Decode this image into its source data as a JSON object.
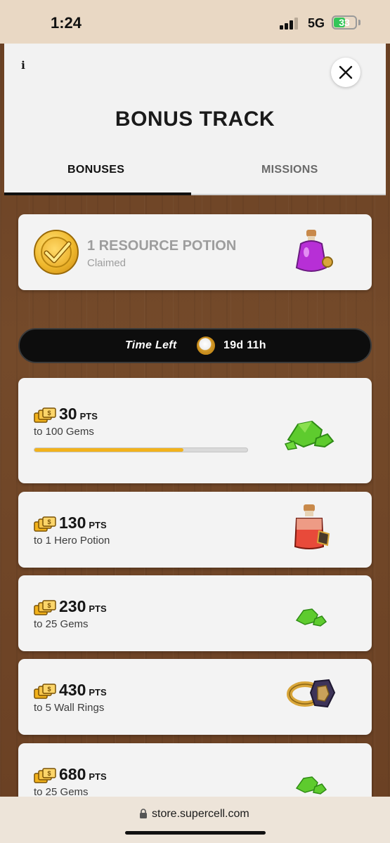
{
  "status_bar": {
    "time": "1:24",
    "network": "5G",
    "battery": "33"
  },
  "header": {
    "title": "BONUS TRACK",
    "info_icon": "i",
    "close_icon": "×"
  },
  "tabs": [
    {
      "label": "BONUSES",
      "active": true
    },
    {
      "label": "MISSIONS",
      "active": false
    }
  ],
  "claimed": {
    "title": "1 RESOURCE POTION",
    "status": "Claimed"
  },
  "timer": {
    "label": "Time Left",
    "value": "19d 11h"
  },
  "milestones": [
    {
      "points": "30",
      "unit": "PTS",
      "reward": "to 100 Gems",
      "icon": "gem-pile-large",
      "progress": 0.7
    },
    {
      "points": "130",
      "unit": "PTS",
      "reward": "to 1 Hero Potion",
      "icon": "hero-potion"
    },
    {
      "points": "230",
      "unit": "PTS",
      "reward": "to 25 Gems",
      "icon": "gem-pile-small"
    },
    {
      "points": "430",
      "unit": "PTS",
      "reward": "to 5 Wall Rings",
      "icon": "wall-ring"
    },
    {
      "points": "680",
      "unit": "PTS",
      "reward": "to 25 Gems",
      "icon": "gem-pile-small"
    }
  ],
  "browser": {
    "url": "store.supercell.com"
  },
  "colors": {
    "wood": "#6e4526",
    "progress": "#f2b21b",
    "accent_gold": "#f0b92e"
  }
}
